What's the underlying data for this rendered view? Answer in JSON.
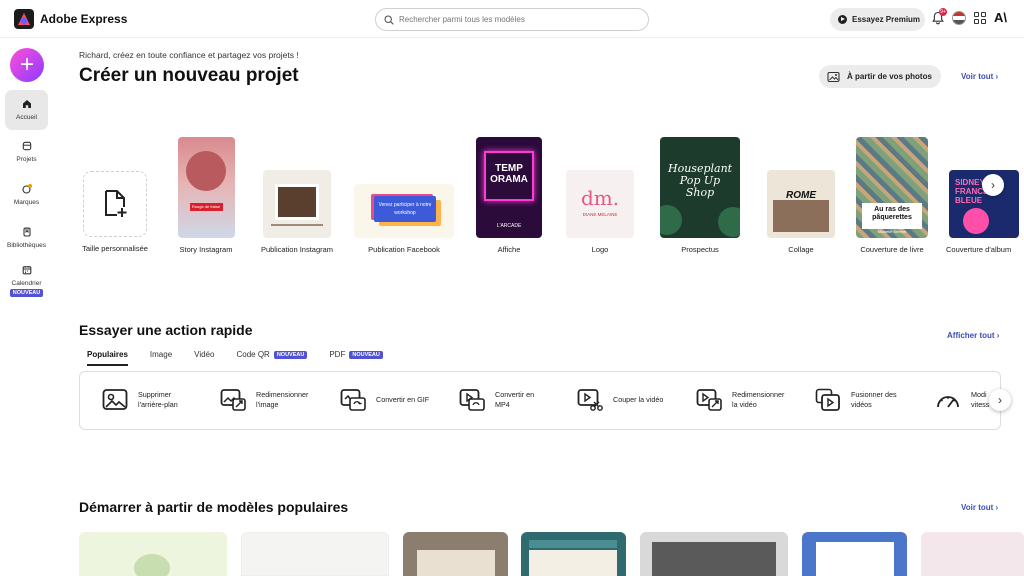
{
  "app": {
    "name": "Adobe Express"
  },
  "search": {
    "placeholder": "Rechercher parmi tous les modèles"
  },
  "header": {
    "premium_label": "Essayez Premium",
    "notification_count": "9+"
  },
  "rail": {
    "items": [
      {
        "label": "Accueil"
      },
      {
        "label": "Projets"
      },
      {
        "label": "Marques"
      },
      {
        "label": "Bibliothèques"
      },
      {
        "label": "Calendrier",
        "badge": "NOUVEAU"
      }
    ]
  },
  "hero": {
    "greeting": "Richard, créez en toute confiance et partagez vos projets !",
    "title": "Créer un nouveau projet",
    "from_photos": "À partir de vos photos",
    "see_all": "Voir tout"
  },
  "projects": [
    {
      "label": "Taille personnalisée"
    },
    {
      "label": "Story Instagram",
      "thumb_title": "Rouge de fraise"
    },
    {
      "label": "Publication Instagram"
    },
    {
      "label": "Publication Facebook",
      "thumb_title": "Venez participer à notre workshop"
    },
    {
      "label": "Affiche",
      "thumb_title": "TEMP ORAMA",
      "thumb_sub": "L'ARCADE"
    },
    {
      "label": "Logo",
      "thumb_title": "dm.",
      "thumb_sub": "DIANE MELAINE"
    },
    {
      "label": "Prospectus",
      "thumb_title": "Houseplant Pop Up Shop"
    },
    {
      "label": "Collage",
      "thumb_title": "ROME"
    },
    {
      "label": "Couverture de livre",
      "thumb_title": "Au ras des pâquerettes",
      "thumb_sub": "Michelle Sérène"
    },
    {
      "label": "Couverture d'album",
      "thumb_title": "SIDNEY FRANCE BLEUE"
    }
  ],
  "quick_actions": {
    "title": "Essayer une action rapide",
    "see_all": "Afficher tout",
    "tabs": [
      {
        "label": "Populaires"
      },
      {
        "label": "Image"
      },
      {
        "label": "Vidéo"
      },
      {
        "label": "Code QR",
        "badge": "NOUVEAU"
      },
      {
        "label": "PDF",
        "badge": "NOUVEAU"
      }
    ],
    "items": [
      {
        "line1": "Supprimer",
        "line2": "l'arrière-plan"
      },
      {
        "line1": "Redimensionner",
        "line2": "l'image"
      },
      {
        "line1": "Convertir en GIF",
        "line2": ""
      },
      {
        "line1": "Convertir en",
        "line2": "MP4"
      },
      {
        "line1": "Couper la vidéo",
        "line2": ""
      },
      {
        "line1": "Redimensionner",
        "line2": "la vidéo"
      },
      {
        "line1": "Fusionner des",
        "line2": "vidéos"
      },
      {
        "line1": "Modi",
        "line2": "vitess"
      }
    ]
  },
  "templates": {
    "title": "Démarrer à partir de modèles populaires",
    "see_all": "Voir tout"
  },
  "colors": {
    "accent": "#3b4fb8",
    "badge": "#5252d4",
    "plus_start": "#ff4fd8",
    "plus_end": "#8a3bff"
  }
}
